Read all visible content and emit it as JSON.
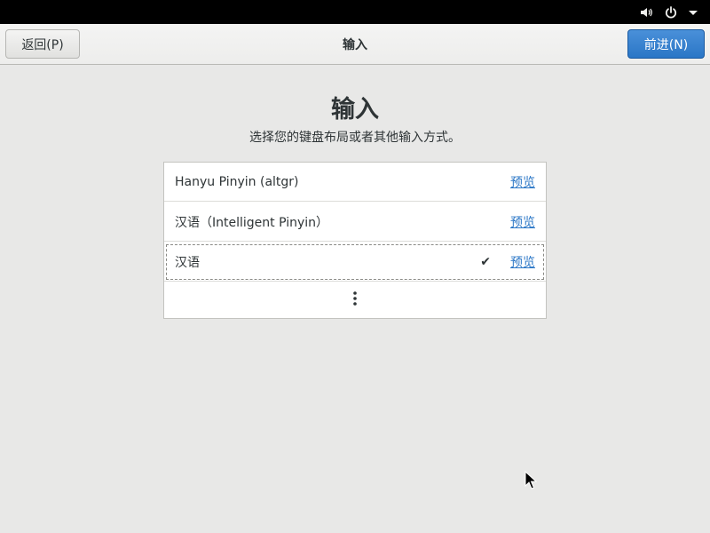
{
  "header": {
    "back_label": "返回(P)",
    "title": "输入",
    "next_label": "前进(N)"
  },
  "page": {
    "title": "输入",
    "subtitle": "选择您的键盘布局或者其他输入方式。"
  },
  "input_sources": [
    {
      "label": "Hanyu Pinyin (altgr)",
      "preview_label": "预览",
      "selected": false
    },
    {
      "label": "汉语（Intelligent Pinyin）",
      "preview_label": "预览",
      "selected": false
    },
    {
      "label": "汉语",
      "preview_label": "预览",
      "selected": true,
      "check_mark": "✔"
    }
  ],
  "icons": {
    "volume": "volume-icon",
    "power": "power-icon",
    "menu": "chevron-down-icon",
    "more": "vertical-ellipsis-icon"
  },
  "colors": {
    "accent": "#2a76c6",
    "background": "#e8e8e7",
    "topbar": "#000000"
  }
}
